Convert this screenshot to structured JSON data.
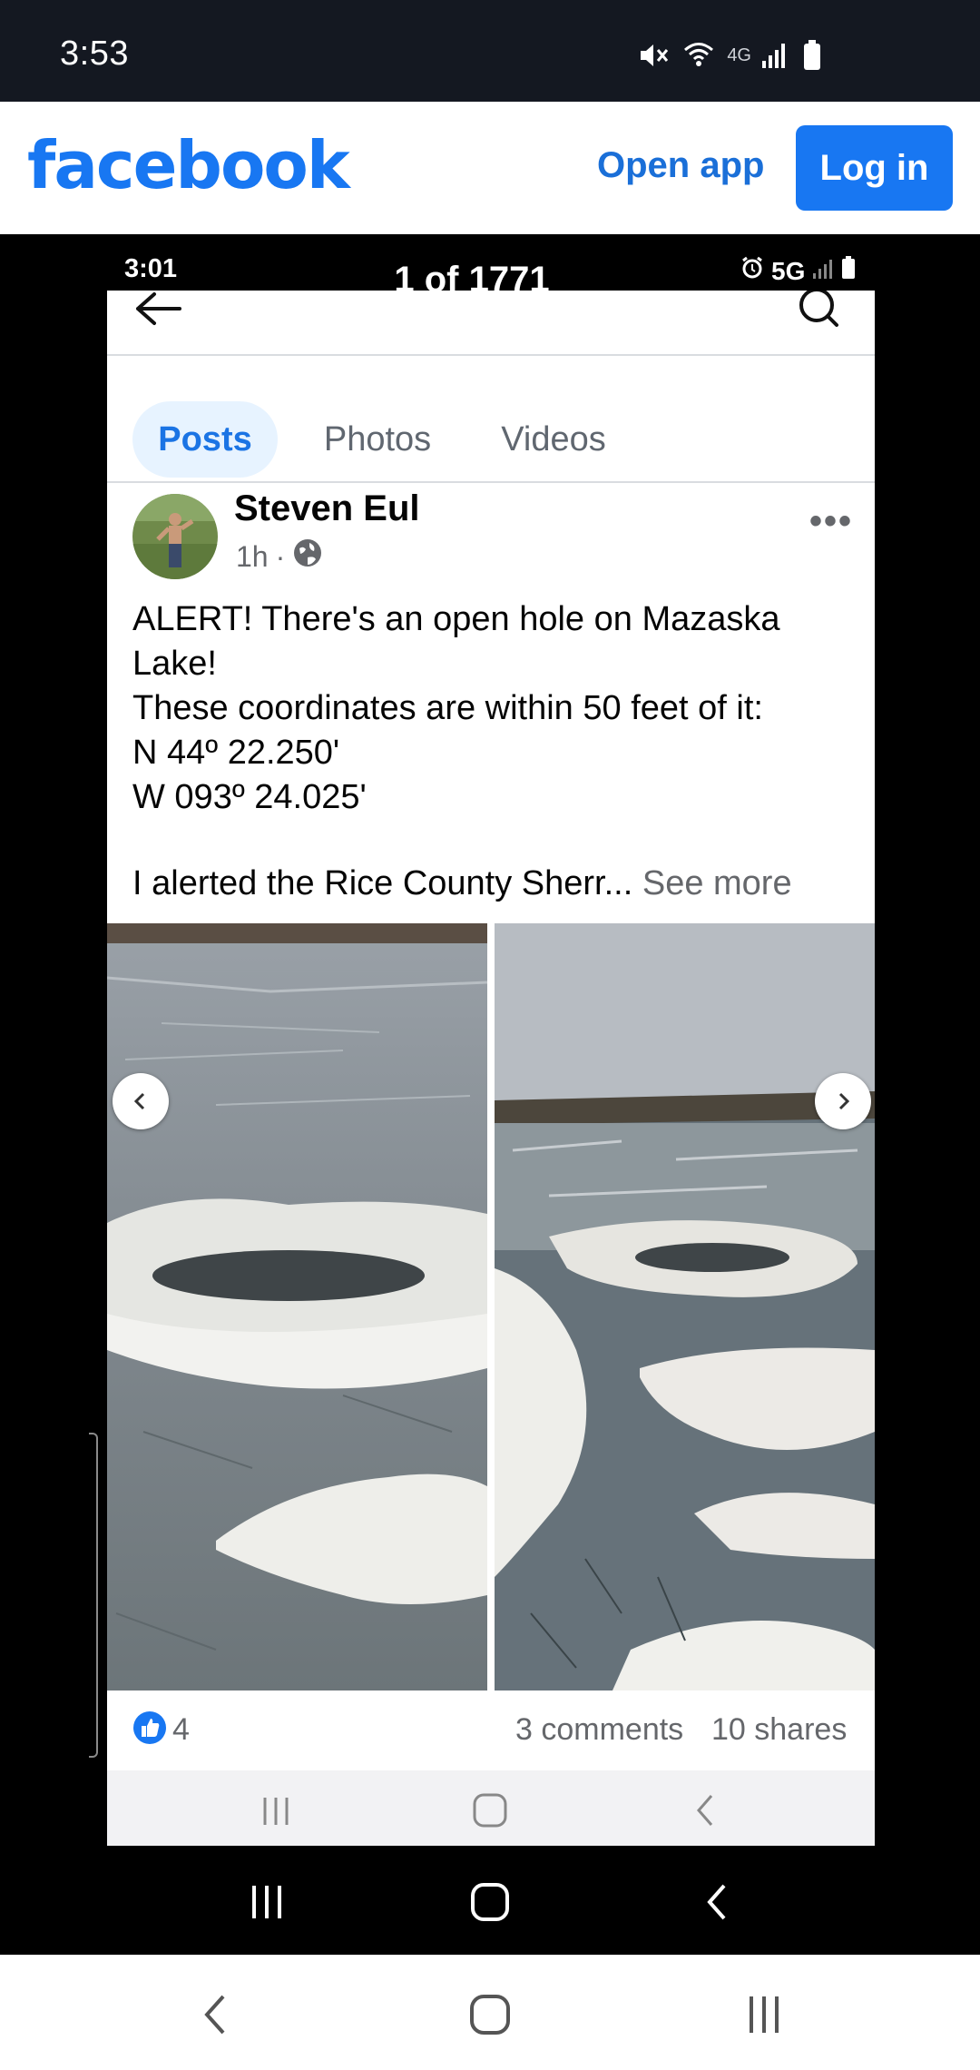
{
  "status_bar": {
    "time": "3:53",
    "network": "4G"
  },
  "header": {
    "logo": "facebook",
    "open_app": "Open app",
    "login": "Log in"
  },
  "inner_status": {
    "time": "3:01",
    "counter": "1 of 1771",
    "network": "5G"
  },
  "tabs": [
    {
      "label": "Posts",
      "active": true
    },
    {
      "label": "Photos",
      "active": false
    },
    {
      "label": "Videos",
      "active": false
    }
  ],
  "post": {
    "author": "Steven Eul",
    "time": "1h",
    "more": "•••",
    "lines": [
      "ALERT! There's an open hole on Mazaska",
      "Lake!",
      "These coordinates are within 50 feet of it:",
      "N 44º 22.250'",
      "W 093º 24.025'"
    ],
    "truncated_line": "I alerted the Rice County Sherr...",
    "see_more": "See more"
  },
  "reactions": {
    "likes": "4",
    "comments": "3 comments",
    "shares": "10 shares"
  },
  "icons": {
    "mute": "mute-icon",
    "wifi": "wifi-icon",
    "signal": "signal-icon",
    "battery": "battery-icon",
    "back": "back-arrow-icon",
    "search": "search-icon",
    "globe": "globe-icon",
    "prev": "chevron-left-icon",
    "next": "chevron-right-icon",
    "like": "like-icon",
    "recents": "recents-icon",
    "home": "home-icon",
    "nav_back": "back-icon",
    "alarm": "alarm-icon"
  },
  "colors": {
    "brand": "#1877f2",
    "status_bar": "#141821",
    "tab_active_bg": "#e7f3ff"
  }
}
